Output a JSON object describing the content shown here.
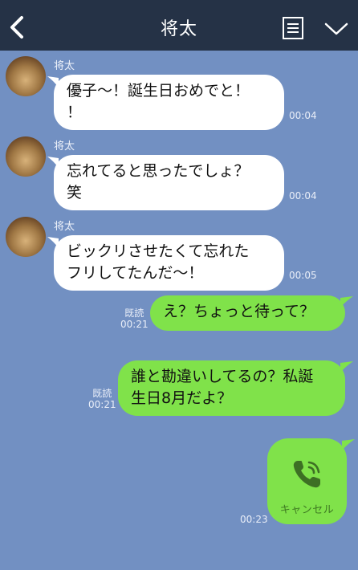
{
  "header": {
    "title": "将太",
    "back_icon": "chevron-left-icon",
    "menu_icon": "notes-icon",
    "expand_icon": "chevron-down-icon",
    "bg_color": "#253246"
  },
  "chat": {
    "bg_color": "#7290c2",
    "incoming": [
      {
        "sender": "将太",
        "lines": [
          "優子〜！誕生日おめでと！",
          "！"
        ],
        "time": "00:04"
      },
      {
        "sender": "将太",
        "lines": [
          "忘れてると思ったでしょ？",
          "笑"
        ],
        "time": "00:04"
      },
      {
        "sender": "将太",
        "lines": [
          "ビックリさせたくて忘れた",
          "フリしてたんだ〜！"
        ],
        "time": "00:05"
      }
    ],
    "outgoing": [
      {
        "lines": [
          "え？ちょっと待って？"
        ],
        "read": "既読",
        "time": "00:21"
      },
      {
        "lines": [
          "誰と勘違いしてるの？私誕",
          "生日8月だよ？"
        ],
        "read": "既読",
        "time": "00:21"
      }
    ],
    "call": {
      "icon": "phone-icon",
      "label": "キャンセル",
      "time": "00:23"
    },
    "bubble_in_color": "#ffffff",
    "bubble_out_color": "#80e24a"
  }
}
